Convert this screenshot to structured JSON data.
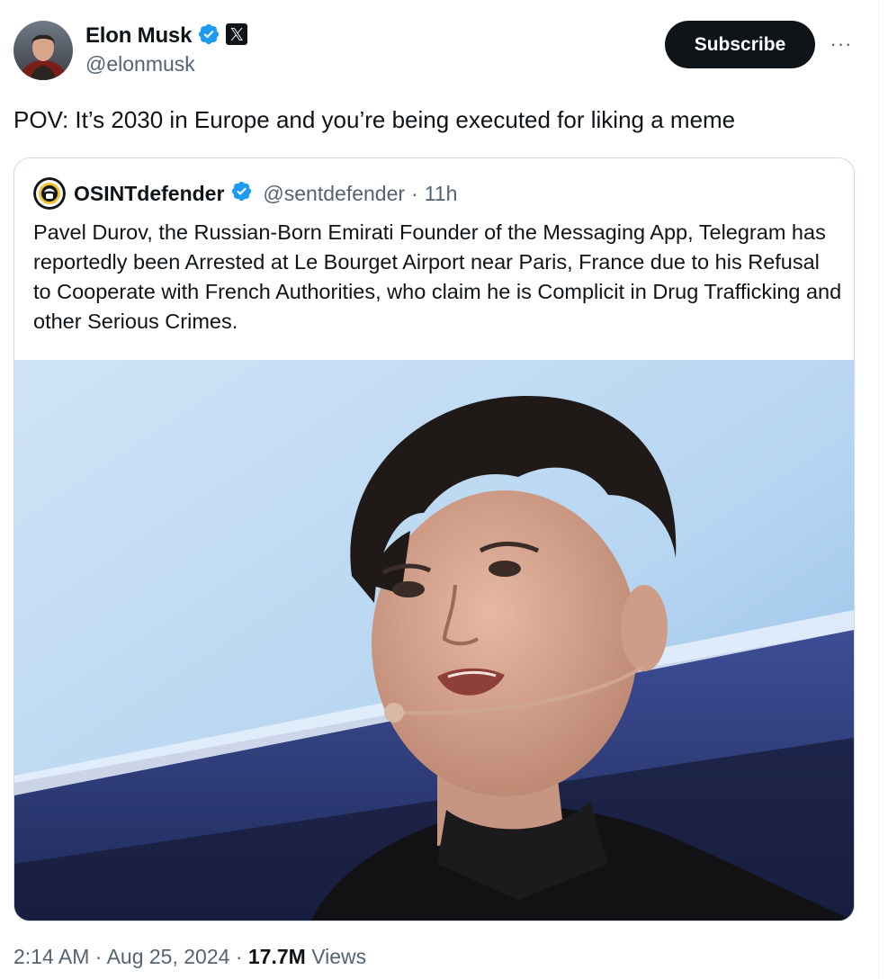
{
  "author": {
    "display_name": "Elon Musk",
    "handle": "@elonmusk",
    "verified_icon": "verified-badge-icon",
    "affiliate_icon": "x-logo-icon"
  },
  "actions": {
    "subscribe_label": "Subscribe",
    "more_label": "···"
  },
  "tweet": {
    "text": "POV: It’s 2030 in Europe and you’re being executed for liking a meme"
  },
  "quoted": {
    "display_name": "OSINTdefender",
    "handle": "@sentdefender",
    "separator": "·",
    "time": "11h",
    "text": "Pavel Durov, the Russian-Born Emirati Founder of the Messaging App, Telegram has reportedly been Arrested at Le Bourget Airport near Paris, France due to his Refusal to Cooperate with French Authorities, who claim he is Complicit in Drug Trafficking and other Serious Crimes."
  },
  "meta": {
    "time": "2:14 AM",
    "sep1": "·",
    "date": "Aug 25, 2024",
    "sep2": "·",
    "views_count": "17.7M",
    "views_label": "Views"
  },
  "colors": {
    "verified_blue": "#1d9bf0",
    "text_primary": "#0f1419",
    "text_secondary": "#536471",
    "border": "#cfd9de",
    "button_bg": "#0f1419"
  }
}
